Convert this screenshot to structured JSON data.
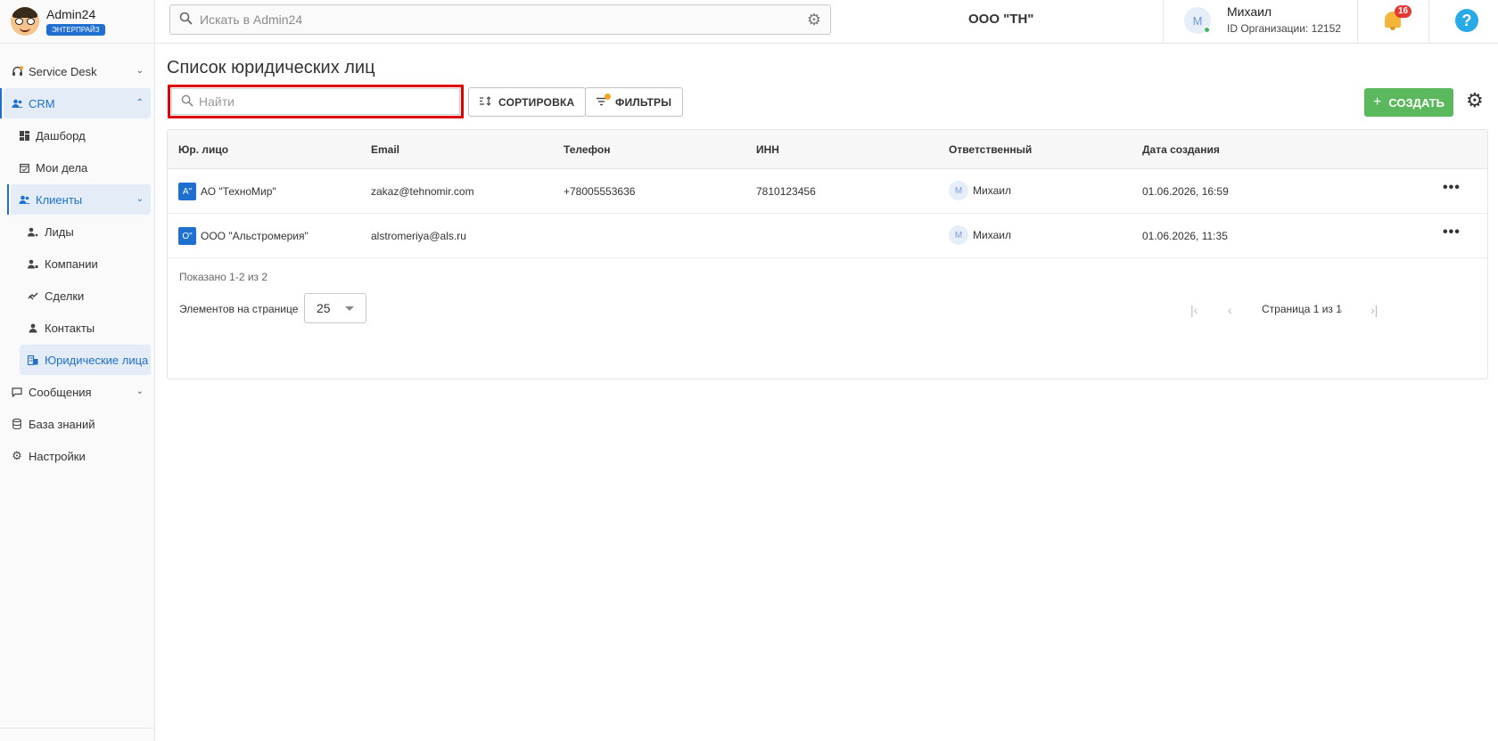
{
  "brand": {
    "name": "Admin24",
    "badge": "ЭНТЕРПРАЙЗ"
  },
  "header": {
    "search_placeholder": "Искать в Admin24",
    "org": "ООО \"ТН\"",
    "user_initial": "М",
    "user_name": "Михаил",
    "user_org_id": "ID Организации: 12152",
    "notifications_count": "16",
    "help": "?"
  },
  "sidebar": {
    "items": [
      {
        "label": "Service Desk"
      },
      {
        "label": "CRM"
      },
      {
        "label": "Дашборд"
      },
      {
        "label": "Мои дела"
      },
      {
        "label": "Клиенты"
      },
      {
        "label": "Лиды"
      },
      {
        "label": "Компании"
      },
      {
        "label": "Сделки"
      },
      {
        "label": "Контакты"
      },
      {
        "label": "Юридические лица"
      },
      {
        "label": "Сообщения"
      },
      {
        "label": "База знаний"
      },
      {
        "label": "Настройки"
      }
    ]
  },
  "main": {
    "title": "Список юридических лиц",
    "search_placeholder": "Найти",
    "sort_label": "СОРТИРОВКА",
    "filters_label": "ФИЛЬТРЫ",
    "create_label": "СОЗДАТЬ",
    "columns": [
      "Юр. лицо",
      "Email",
      "Телефон",
      "ИНН",
      "Ответственный",
      "Дата создания"
    ],
    "rows": [
      {
        "badge": "А\"",
        "name": "АО \"ТехноМир\"",
        "email": "zakaz@tehnomir.com",
        "phone": "+78005553636",
        "inn": "7810123456",
        "resp_initial": "М",
        "responsible": "Михаил",
        "created": "01.06.2026, 16:59",
        "more": "•••"
      },
      {
        "badge": "О\"",
        "name": "ООО \"Альстромерия\"",
        "email": "alstromeriya@als.ru",
        "phone": "",
        "inn": "",
        "resp_initial": "М",
        "responsible": "Михаил",
        "created": "01.06.2026, 11:35",
        "more": "•••"
      }
    ],
    "shown_text": "Показано 1-2 из 2",
    "per_page_label": "Элементов на странице",
    "per_page_value": "25",
    "page_info": "Страница 1 из 1"
  },
  "colors": {
    "accent": "#1f6fd1",
    "create": "#5cb85c",
    "highlight": "#e00000",
    "notification": "#e53935"
  }
}
